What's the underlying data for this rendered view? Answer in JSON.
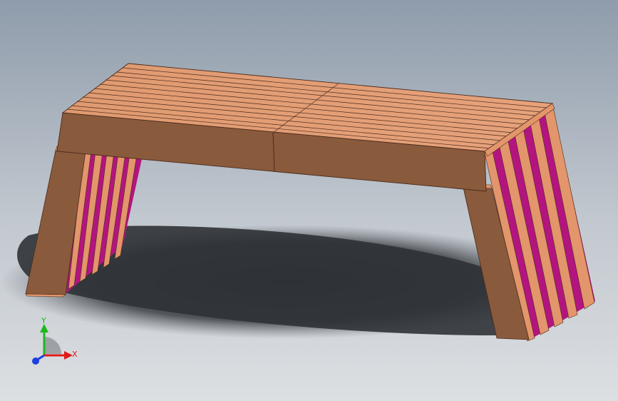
{
  "viewport": {
    "background_top": "#8f9cab",
    "background_bottom": "#d9dce0",
    "shadow_color": "#2e3033"
  },
  "model": {
    "type": "bench",
    "wood_top_color": "#e3956b",
    "wood_side_color": "#8a5a3c",
    "wood_dark_color": "#6e432c",
    "slat_line_color": "#4a2b1c",
    "gap_color": "#b3147f"
  },
  "triad": {
    "x_label": "X",
    "y_label": "Y",
    "x_color": "#e01b1b",
    "y_color": "#1db81d",
    "z_color": "#1f3fe0"
  }
}
